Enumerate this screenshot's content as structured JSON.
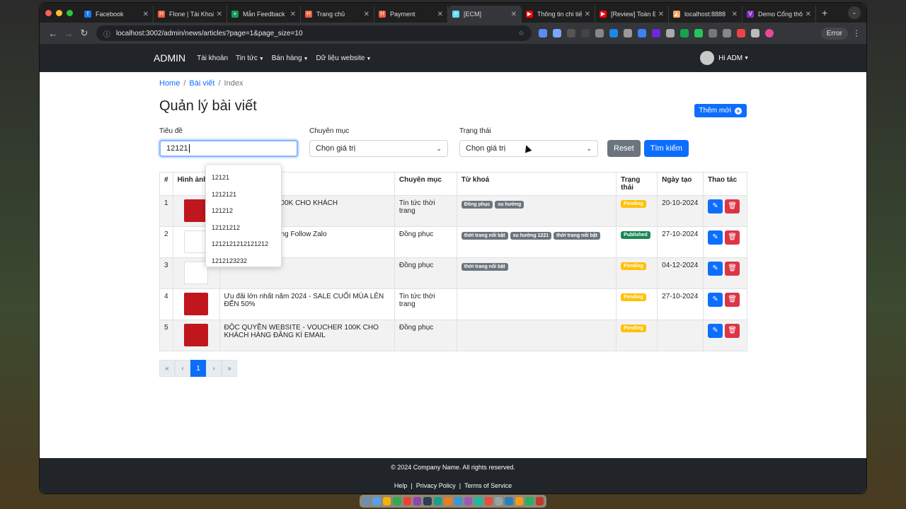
{
  "browser": {
    "tabs": [
      {
        "title": "Facebook",
        "favicon_color": "#1877f2",
        "glyph": "f"
      },
      {
        "title": "Flone | Tài Khoản",
        "favicon_color": "#e85d3a",
        "glyph": "H"
      },
      {
        "title": "Mẫn Feedback",
        "favicon_color": "#0f9d58",
        "glyph": "+"
      },
      {
        "title": "Trang chủ",
        "favicon_color": "#e85d3a",
        "glyph": "H"
      },
      {
        "title": "Payment",
        "favicon_color": "#e85d3a",
        "glyph": "H"
      },
      {
        "title": "[ECM]",
        "favicon_color": "#61dafb",
        "glyph": "⚛"
      },
      {
        "title": "Thông tin chi tiết",
        "favicon_color": "#ff0000",
        "glyph": "▶"
      },
      {
        "title": "[Review] Toàn Bộ",
        "favicon_color": "#ff0000",
        "glyph": "▶"
      },
      {
        "title": "localhost:8888",
        "favicon_color": "#f4a261",
        "glyph": "◭"
      },
      {
        "title": "Demo Cổng thông tin",
        "favicon_color": "#7b2cbf",
        "glyph": "V"
      }
    ],
    "active_tab_index": 5,
    "url": "localhost:3002/admin/news/articles?page=1&page_size=10",
    "error_label": "Error"
  },
  "nav": {
    "brand": "ADMIN",
    "items": [
      "Tài khoản",
      "Tin tức",
      "Bán hàng",
      "Dữ liệu website"
    ],
    "user_label": "Hi ADM"
  },
  "breadcrumb": {
    "home": "Home",
    "section": "Bài viết",
    "current": "Index"
  },
  "page": {
    "title": "Quản lý bài viết",
    "add_button": "Thêm mới"
  },
  "filters": {
    "title_label": "Tiêu đề",
    "title_value": "12121",
    "category_label": "Chuyên mục",
    "category_value": "Chọn giá trị",
    "status_label": "Trạng thái",
    "status_value": "Chọn giá trị",
    "reset": "Reset",
    "search": "Tìm kiếm"
  },
  "autocomplete": [
    "12121",
    "1212121",
    "121212",
    "12121212",
    "1212121212121212",
    "1212123232"
  ],
  "table": {
    "headers": [
      "#",
      "Hình ảnh",
      "Tiêu đề",
      "Chuyên mục",
      "Từ khoá",
      "Trạng thái",
      "Ngày tạo",
      "Thao tác"
    ],
    "rows": [
      {
        "no": "1",
        "title": "ĐỘC QUYỀN WEBSITE - VOUCHER 100K CHO KHÁCH HÀNG ĐĂNG KÍ EMAIL",
        "title_visible": "TE - VOUCHER 100K CHO KHÁCH\nAIL",
        "category": "Tin tức thời trang",
        "tags": [
          "Đồng phục",
          "xu hướng"
        ],
        "status": "Pending",
        "date": "20-10-2024",
        "thumb": "red"
      },
      {
        "no": "2",
        "title": "25K cho khách hàng Follow Zalo\n2",
        "category": "Đồng phục",
        "tags": [
          "thời trang nổi bật",
          "xu hướng 1221",
          "thời trang nổi bật"
        ],
        "status": "Published",
        "date": "27-10-2024",
        "thumb": "white"
      },
      {
        "no": "3",
        "title": "",
        "category": "Đồng phục",
        "tags": [
          "thời trang nổi bật"
        ],
        "status": "Pending",
        "date": "04-12-2024",
        "thumb": "white"
      },
      {
        "no": "4",
        "title": "Ưu đãi lớn nhất năm 2024 - SALE CUỐI MÙA LÊN ĐẾN 50%",
        "category": "Tin tức thời trang",
        "tags": [],
        "status": "Pending",
        "date": "27-10-2024",
        "thumb": "red"
      },
      {
        "no": "5",
        "title": "ĐỘC QUYỀN WEBSITE - VOUCHER 100K CHO KHÁCH HÀNG ĐĂNG KÍ EMAIL",
        "category": "Đồng phục",
        "tags": [],
        "status": "Pending",
        "date": "",
        "thumb": "red"
      }
    ]
  },
  "pagination": [
    "«",
    "‹",
    "1",
    "›",
    "»"
  ],
  "pagination_current": "1",
  "footer": {
    "copyright": "© 2024 Company Name. All rights reserved.",
    "links": [
      "Help",
      "Privacy Policy",
      "Terms of Service"
    ]
  },
  "colors": {
    "primary": "#0d6efd",
    "danger": "#dc3545",
    "pending": "#ffc107",
    "published": "#198754",
    "navbar": "#212529"
  }
}
